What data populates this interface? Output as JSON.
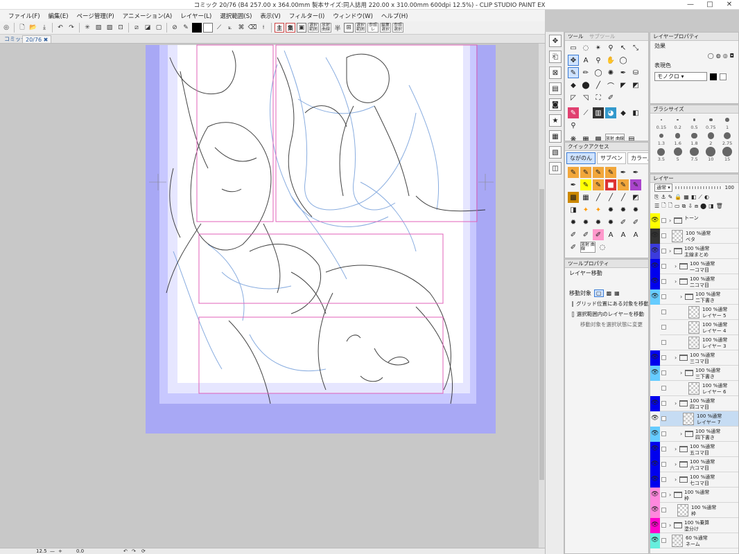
{
  "window": {
    "title": "コミック 20/76 (B4 257.00 x 364.00mm 製本サイズ:同人誌用 220.00 x 310.00mm 600dpi 12.5%) - CLIP STUDIO PAINT EX",
    "minimize": "—",
    "maximize": "□",
    "close": "✕"
  },
  "menu": [
    "ファイル(F)",
    "編集(E)",
    "ページ管理(P)",
    "アニメーション(A)",
    "レイヤー(L)",
    "選択範囲(S)",
    "表示(V)",
    "フィルター(I)",
    "ウィンドウ(W)",
    "ヘルプ(H)"
  ],
  "toolbar": {
    "kanji1": "主",
    "kanji2": "集",
    "btn_ichiji": "一時",
    "btn_han": "半",
    "lbl_a": "選択 範囲",
    "lbl_b": "放射 曲線",
    "lbl_c": "選択 範囲",
    "lbl_d": "参照 レ",
    "lbl_e": "編集 選択",
    "lbl_f": "参照 選択"
  },
  "tabs": {
    "canvas_tab": "コミック",
    "page_tab": "20/76 ✖"
  },
  "status": {
    "zoom": "12.5",
    "angle": "0.0"
  },
  "panels": {
    "tool_tab1": "ツール",
    "tool_tab2": "サブツール",
    "quick_access": "クイックアクセス",
    "qa_tabs": [
      {
        "label": "ながのん",
        "active": true
      },
      {
        "label": "サブペン",
        "active": false
      },
      {
        "label": "カラー用",
        "active": false
      }
    ],
    "qa_label_a": "放射 曲線",
    "qa_label_b": "放射 曲線",
    "tool_property": "ツールプロパティ",
    "tool_property_sub": "レイヤー移動",
    "move_target_label": "移動対象",
    "opt1": "グリッド位置にある対象を移動",
    "opt2": "選択範囲内のレイヤーを移動",
    "opt3": "移動対象を選択状態に変更",
    "layer_property": "レイヤープロパティ",
    "effect_label": "効果",
    "expression_label": "表現色",
    "expression_value": "モノクロ",
    "brush_size": "ブラシサイズ",
    "brush_sizes": [
      "0.15",
      "0.2",
      "0.5",
      "0.75",
      "1",
      "1.3",
      "1.6",
      "1.8",
      "2",
      "2.75",
      "3.5",
      "5",
      "7.5",
      "10",
      "15"
    ],
    "layer_panel": "レイヤー",
    "blend_mode": "通常",
    "opacity": "100"
  },
  "layers": [
    {
      "l1": "トーン",
      "l2": "",
      "color": "#ffff00",
      "indent": 0,
      "type": "folder",
      "eye": true
    },
    {
      "l1": "100 %通常",
      "l2": "ベタ",
      "color": "#333333",
      "indent": 0,
      "type": "layer",
      "eye": true
    },
    {
      "l1": "100 %通常",
      "l2": "主線まとめ",
      "color": "#3b3bdd",
      "indent": 0,
      "type": "folder",
      "eye": true
    },
    {
      "l1": "100 %通常",
      "l2": "一コマ目",
      "color": "#0000ee",
      "indent": 1,
      "type": "folder",
      "eye": true
    },
    {
      "l1": "100 %通常",
      "l2": "二コマ目",
      "color": "#0000ee",
      "indent": 1,
      "type": "folder",
      "eye": true
    },
    {
      "l1": "100 %通常",
      "l2": "二下書き",
      "color": "#66ccff",
      "indent": 2,
      "type": "folder",
      "eye": true
    },
    {
      "l1": "100 %通常",
      "l2": "レイヤー 5",
      "color": "#f4f4f4",
      "indent": 3,
      "type": "layer",
      "eye": false
    },
    {
      "l1": "100 %通常",
      "l2": "レイヤー 4",
      "color": "#f4f4f4",
      "indent": 3,
      "type": "layer",
      "eye": false
    },
    {
      "l1": "100 %通常",
      "l2": "レイヤー 3",
      "color": "#f4f4f4",
      "indent": 3,
      "type": "layer",
      "eye": false
    },
    {
      "l1": "100 %通常",
      "l2": "三コマ目",
      "color": "#0000ee",
      "indent": 1,
      "type": "folder",
      "eye": true
    },
    {
      "l1": "100 %通常",
      "l2": "三下書き",
      "color": "#66ccff",
      "indent": 2,
      "type": "folder",
      "eye": true
    },
    {
      "l1": "100 %通常",
      "l2": "レイヤー 6",
      "color": "#f4f4f4",
      "indent": 3,
      "type": "layer",
      "eye": false
    },
    {
      "l1": "100 %通常",
      "l2": "四コマ目",
      "color": "#0000ee",
      "indent": 1,
      "type": "folder",
      "eye": true
    },
    {
      "l1": "100 %通常",
      "l2": "レイヤー 7",
      "color": "#f4f4f4",
      "indent": 2,
      "type": "layer",
      "eye": true,
      "selected": true
    },
    {
      "l1": "100 %通常",
      "l2": "四下書き",
      "color": "#66ccff",
      "indent": 2,
      "type": "folder",
      "eye": true
    },
    {
      "l1": "100 %通常",
      "l2": "五コマ目",
      "color": "#0000ee",
      "indent": 1,
      "type": "folder",
      "eye": true
    },
    {
      "l1": "100 %通常",
      "l2": "六コマ目",
      "color": "#0000ee",
      "indent": 1,
      "type": "folder",
      "eye": true
    },
    {
      "l1": "100 %通常",
      "l2": "七コマ目",
      "color": "#0000ee",
      "indent": 1,
      "type": "folder",
      "eye": true
    },
    {
      "l1": "100 %通常",
      "l2": "枠",
      "color": "#ff88dd",
      "indent": 0,
      "type": "folder",
      "eye": true
    },
    {
      "l1": "100 %通常",
      "l2": "枠",
      "color": "#ff88dd",
      "indent": 1,
      "type": "layer",
      "eye": true
    },
    {
      "l1": "100 %乗算",
      "l2": "塗分け",
      "color": "#ff00cc",
      "indent": 0,
      "type": "folder",
      "eye": true
    },
    {
      "l1": "60 %通常",
      "l2": "ネーム",
      "color": "#66eedd",
      "indent": 0,
      "type": "layer",
      "eye": true
    }
  ]
}
